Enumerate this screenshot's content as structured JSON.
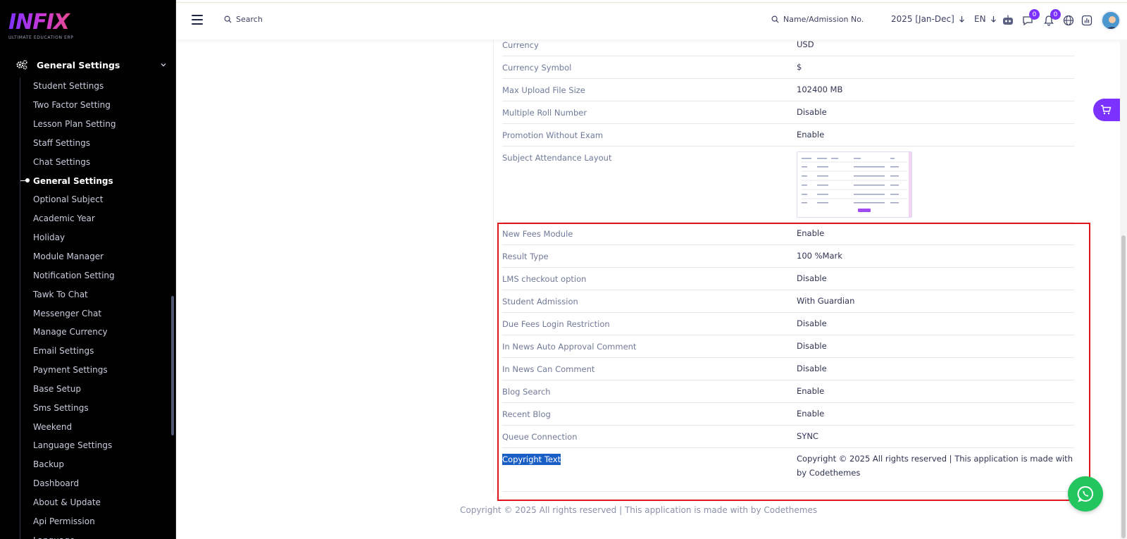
{
  "brand": {
    "logo": "INFIX",
    "tagline": "ULTIMATE EDUCATION ERP"
  },
  "sidebar": {
    "section_title": "General Settings",
    "items": [
      {
        "label": "Student Settings"
      },
      {
        "label": "Two Factor Setting"
      },
      {
        "label": "Lesson Plan Setting"
      },
      {
        "label": "Staff Settings"
      },
      {
        "label": "Chat Settings"
      },
      {
        "label": "General Settings",
        "active": true
      },
      {
        "label": "Optional Subject"
      },
      {
        "label": "Academic Year"
      },
      {
        "label": "Holiday"
      },
      {
        "label": "Module Manager"
      },
      {
        "label": "Notification Setting"
      },
      {
        "label": "Tawk To Chat"
      },
      {
        "label": "Messenger Chat"
      },
      {
        "label": "Manage Currency"
      },
      {
        "label": "Email Settings"
      },
      {
        "label": "Payment Settings"
      },
      {
        "label": "Base Setup"
      },
      {
        "label": "Sms Settings"
      },
      {
        "label": "Weekend"
      },
      {
        "label": "Language Settings"
      },
      {
        "label": "Backup"
      },
      {
        "label": "Dashboard"
      },
      {
        "label": "About & Update"
      },
      {
        "label": "Api Permission"
      },
      {
        "label": "Language"
      }
    ]
  },
  "header": {
    "search_label": "Search",
    "student_search_label": "Name/Admission No.",
    "academic_year": "2025 [Jan-Dec]",
    "language": "EN",
    "chat_count": "0",
    "notification_count": "0"
  },
  "settings": {
    "rows_top": [
      {
        "label": "Currency",
        "value": "USD"
      },
      {
        "label": "Currency Symbol",
        "value": "$"
      },
      {
        "label": "Max Upload File Size",
        "value": "102400 MB"
      },
      {
        "label": "Multiple Roll Number",
        "value": "Disable"
      },
      {
        "label": "Promotion Without Exam",
        "value": "Enable"
      }
    ],
    "layout_row": {
      "label": "Subject Attendance Layout"
    },
    "rows_bottom": [
      {
        "label": "New Fees Module",
        "value": "Enable"
      },
      {
        "label": "Result Type",
        "value": "100 %Mark"
      },
      {
        "label": "LMS checkout option",
        "value": "Disable"
      },
      {
        "label": "Student Admission",
        "value": "With Guardian"
      },
      {
        "label": "Due Fees Login Restriction",
        "value": "Disable"
      },
      {
        "label": "In News Auto Approval Comment",
        "value": "Disable"
      },
      {
        "label": "In News Can Comment",
        "value": "Disable"
      },
      {
        "label": "Blog Search",
        "value": "Enable"
      },
      {
        "label": "Recent Blog",
        "value": "Enable"
      },
      {
        "label": "Queue Connection",
        "value": "SYNC"
      }
    ],
    "copyright_row": {
      "label": "Copyright Text",
      "value": "Copyright © 2025 All rights reserved | This application is made with by Codethemes"
    }
  },
  "footer": {
    "text": "Copyright © 2025 All rights reserved | This application is made with by Codethemes"
  },
  "colors": {
    "accent": "#7c32ff",
    "highlight_box": "#e1151d",
    "whatsapp": "#22c55e",
    "selection": "#1a5fc6"
  }
}
